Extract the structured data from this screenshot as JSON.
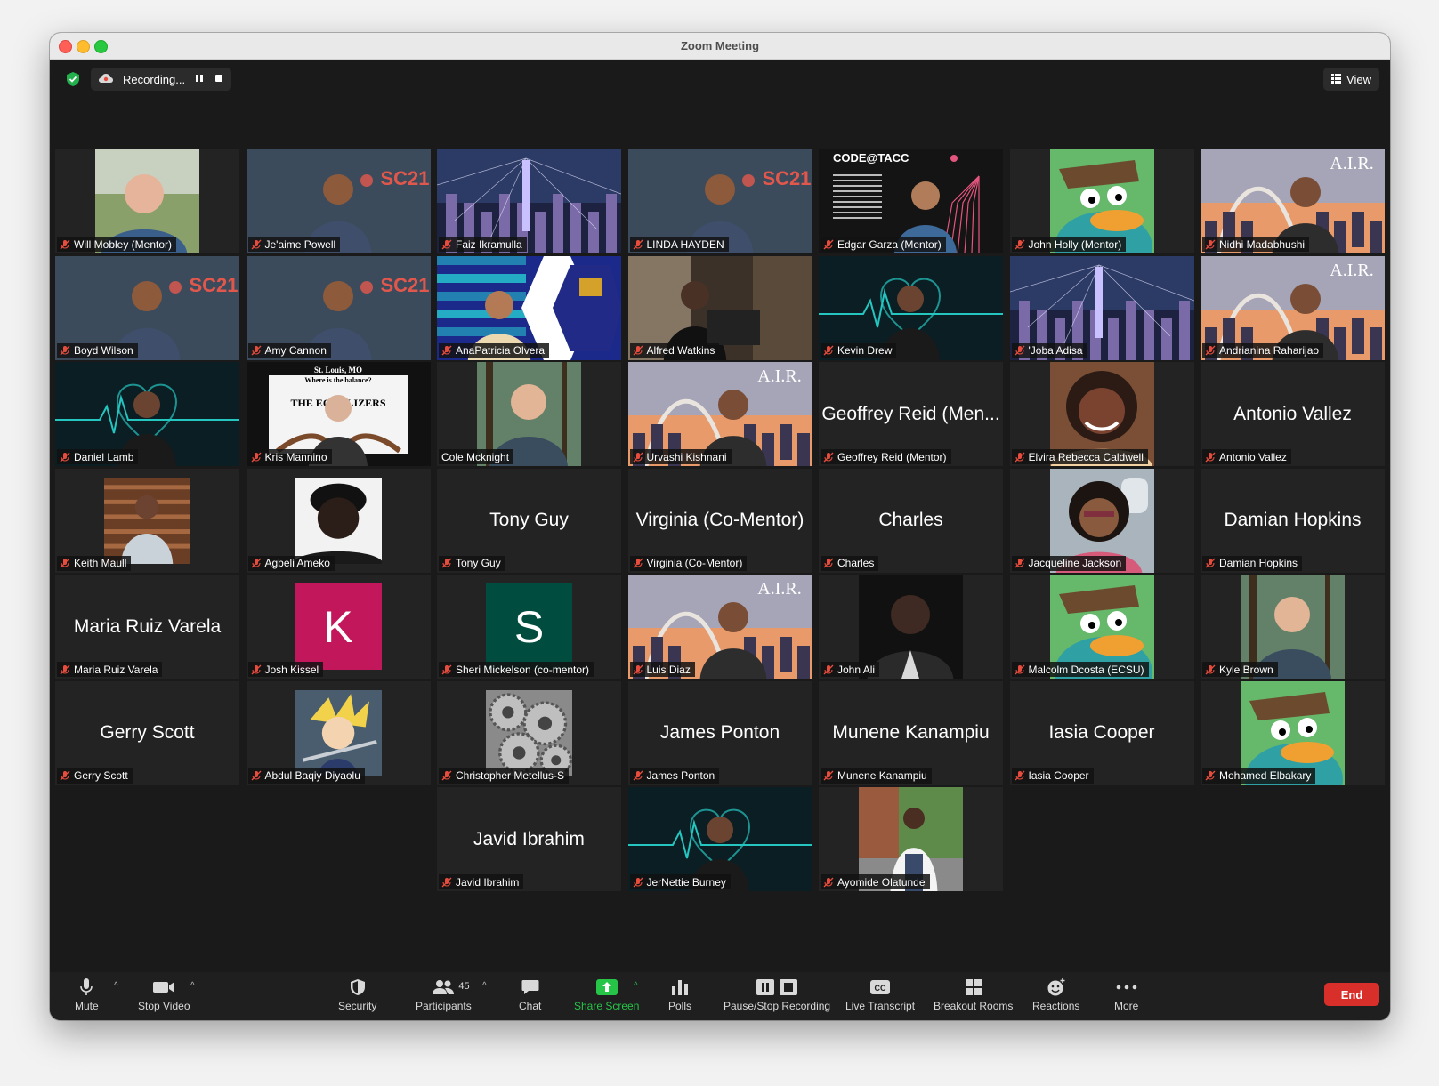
{
  "window": {
    "title": "Zoom Meeting"
  },
  "topbar": {
    "recording_label": "Recording...",
    "view_label": "View"
  },
  "participants": [
    {
      "name": "Will Mobley (Mentor)",
      "photo": "indoor-bright"
    },
    {
      "name": "Je'aime Powell",
      "photo": "sc21-backdrop"
    },
    {
      "name": "Faiz Ikramulla",
      "photo": "city-network"
    },
    {
      "name": "LINDA HAYDEN",
      "photo": "sc21-backdrop"
    },
    {
      "name": "Edgar Garza (Mentor)",
      "photo": "code-tacc"
    },
    {
      "name": "John Holly (Mentor)",
      "photo": "cartoon-platypus"
    },
    {
      "name": "Nidhi Madabhushi",
      "photo": "air-sunset",
      "active_speaker": true
    },
    {
      "name": "Boyd Wilson",
      "photo": "sc21-backdrop"
    },
    {
      "name": "Amy Cannon",
      "photo": "sc21-backdrop"
    },
    {
      "name": "AnaPatricia Olvera",
      "photo": "game-hexagon"
    },
    {
      "name": "Alfred Watkins",
      "photo": "indoor-dim"
    },
    {
      "name": "Kevin Drew",
      "photo": "heartbeat-dark"
    },
    {
      "name": "'Joba Adisa",
      "photo": "city-network"
    },
    {
      "name": "Andrianina Raharijao",
      "photo": "air-sunset"
    },
    {
      "name": "Daniel Lamb",
      "photo": "heartbeat-dark"
    },
    {
      "name": "Kris Mannino",
      "photo": "equalizers-poster"
    },
    {
      "name": "Cole Mcknight",
      "photo": "outdoor-trees",
      "unmuted": true
    },
    {
      "name": "Urvashi Kishnani",
      "photo": "air-sunset"
    },
    {
      "name": "Geoffrey Reid (Mentor)",
      "display": "Geoffrey Reid (Men..."
    },
    {
      "name": "Elvira Rebecca Caldwell",
      "photo": "portrait-warm"
    },
    {
      "name": "Antonio Vallez",
      "display": "Antonio Vallez"
    },
    {
      "name": "Keith Maull",
      "photo": "library"
    },
    {
      "name": "Agbeli Ameko",
      "photo": "portrait-bw"
    },
    {
      "name": "Tony Guy",
      "display": "Tony Guy"
    },
    {
      "name": "Virginia (Co-Mentor)",
      "display": "Virginia (Co-Mentor)"
    },
    {
      "name": "Charles",
      "display": "Charles"
    },
    {
      "name": "Jacqueline Jackson",
      "photo": "portrait-plane"
    },
    {
      "name": "Damian Hopkins",
      "display": "Damian Hopkins"
    },
    {
      "name": "Maria Ruiz Varela",
      "display": "Maria Ruiz Varela"
    },
    {
      "name": "Josh Kissel",
      "letter": "K",
      "color": "#c2185b"
    },
    {
      "name": "Sheri Mickelson (co-mentor)",
      "letter": "S",
      "color": "#004d40"
    },
    {
      "name": "Luis Diaz",
      "photo": "air-sunset"
    },
    {
      "name": "John Ali",
      "photo": "portrait-dark"
    },
    {
      "name": "Malcolm Dcosta (ECSU)",
      "photo": "cartoon-platypus"
    },
    {
      "name": "Kyle Brown",
      "photo": "outdoor-trees"
    },
    {
      "name": "Gerry Scott",
      "display": "Gerry Scott"
    },
    {
      "name": "Abdul Baqiy Diyaolu",
      "photo": "anime"
    },
    {
      "name": "Christopher Metellus-S",
      "photo": "gears"
    },
    {
      "name": "James Ponton",
      "display": "James Ponton"
    },
    {
      "name": "Munene Kanampiu",
      "display": "Munene Kanampiu"
    },
    {
      "name": "Iasia Cooper",
      "display": "Iasia Cooper"
    },
    {
      "name": "Mohamed Elbakary",
      "photo": "cartoon-platypus"
    },
    {
      "name": "Javid Ibrahim",
      "display": "Javid Ibrahim"
    },
    {
      "name": "JerNettie Burney",
      "photo": "heartbeat-dark"
    },
    {
      "name": "Ayomide Olatunde",
      "photo": "outdoor-street"
    }
  ],
  "toolbar": {
    "mute_label": "Mute",
    "video_label": "Stop Video",
    "security_label": "Security",
    "participants_label": "Participants",
    "participants_count": "45",
    "chat_label": "Chat",
    "share_label": "Share Screen",
    "polls_label": "Polls",
    "recording_label": "Pause/Stop Recording",
    "transcript_label": "Live Transcript",
    "breakout_label": "Breakout Rooms",
    "reactions_label": "Reactions",
    "more_label": "More",
    "end_label": "End"
  },
  "colors": {
    "active_speaker_border": "#d3de5a",
    "share_green": "#26c548",
    "end_red": "#d82f2a",
    "mic_off_red": "#e74c3c"
  }
}
